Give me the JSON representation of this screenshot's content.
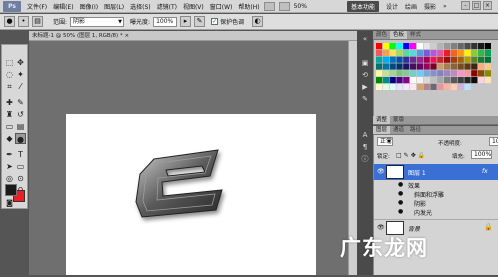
{
  "app": {
    "logo": "Ps",
    "menus": [
      "文件(F)",
      "编辑(E)",
      "图像(I)",
      "图层(L)",
      "选择(S)",
      "滤镜(T)",
      "视图(V)",
      "窗口(W)",
      "帮助(H)"
    ],
    "zoom": "50%",
    "workspaces": {
      "active": "基本功能",
      "others": [
        "设计",
        "绘画",
        "摄影"
      ],
      "more": "»"
    },
    "window_controls": [
      "-",
      "□",
      "×"
    ]
  },
  "options": {
    "range_label": "范围:",
    "range_value": "阴影",
    "exposure_label": "曝光度:",
    "exposure_value": "100%",
    "protect_tone_label": "保护色调",
    "protect_tone_checked": true
  },
  "document": {
    "tab_title": "未标题-1 @ 50% (图层 1, RGB/8) * ×"
  },
  "swatches": {
    "tabs": [
      "颜色",
      "色板",
      "样式"
    ],
    "active_tab": 1,
    "colors": [
      "#ff0000",
      "#ffff00",
      "#00ff00",
      "#00ffff",
      "#0000ff",
      "#ff00ff",
      "#ffffff",
      "#e6e6e6",
      "#cccccc",
      "#b3b3b3",
      "#999999",
      "#808080",
      "#666666",
      "#4d4d4d",
      "#333333",
      "#1a1a1a",
      "#000000",
      "#f25a5a",
      "#f5a05a",
      "#fbe25a",
      "#a7d95a",
      "#5ad99a",
      "#5ad9d9",
      "#5a9ad9",
      "#7a5ad9",
      "#b45ad9",
      "#d95aa7",
      "#ee1c24",
      "#f26522",
      "#f7941d",
      "#fff200",
      "#8dc63f",
      "#39b54a",
      "#00a651",
      "#00a99d",
      "#00aeef",
      "#0072bc",
      "#0054a6",
      "#2e3192",
      "#662d91",
      "#92278f",
      "#9e005d",
      "#ed145b",
      "#c1272d",
      "#9e0b0f",
      "#a0410d",
      "#a36209",
      "#aba000",
      "#598527",
      "#1a7b30",
      "#007236",
      "#00746b",
      "#0076a3",
      "#004a80",
      "#003471",
      "#1b1464",
      "#440e62",
      "#630460",
      "#9e005d",
      "#7a0026",
      "#c69c6d",
      "#a67c52",
      "#8c6239",
      "#754c24",
      "#603913",
      "#3c2415",
      "#f9ad81",
      "#fdc68a",
      "#fff799",
      "#c4df9b",
      "#a3d39c",
      "#7cc576",
      "#82ca9c",
      "#7accc8",
      "#6dcff6",
      "#7da7d9",
      "#8393ca",
      "#8781bd",
      "#a186be",
      "#bd8cbf",
      "#f49ac2",
      "#f6989d",
      "#8a0000",
      "#8a4a00",
      "#8a8a00",
      "#008a00",
      "#008a8a",
      "#00008a",
      "#4a008a",
      "#8a008a",
      "#ffffff",
      "#f2f2f2",
      "#d9d9d9",
      "#bfbfbf",
      "#a6a6a6",
      "#7f7f7f",
      "#595959",
      "#404040",
      "#262626",
      "#0d0d0d",
      "#ffd1dc",
      "#ffe4b5",
      "#fffacd",
      "#e0ffe0",
      "#e0ffff",
      "#e6e6fa",
      "#f5e6ff",
      "#ffe6f2",
      "#d4a373",
      "#b5838d",
      "#6d6875",
      "#e5989b",
      "#ffb4a2",
      "#ffcdb2",
      "#cdb4db",
      "#bde0fe"
    ]
  },
  "adjustments": {
    "tabs": [
      "调整",
      "蒙版"
    ]
  },
  "layers": {
    "tabs": [
      "图层",
      "通道",
      "路径"
    ],
    "blend_mode": "正常",
    "opacity_label": "不透明度:",
    "opacity_value": "100%",
    "lock_label": "锁定:",
    "fill_label": "填充:",
    "fill_value": "100%",
    "items": [
      {
        "name": "图层 1",
        "selected": true,
        "fx": "fx"
      },
      {
        "name": "效果",
        "sub": true
      },
      {
        "name": "斜面和浮雕",
        "sub": true
      },
      {
        "name": "阴影",
        "sub": true
      },
      {
        "name": "内发光",
        "sub": true
      }
    ],
    "background": "背景"
  },
  "watermark": "广东龙网"
}
